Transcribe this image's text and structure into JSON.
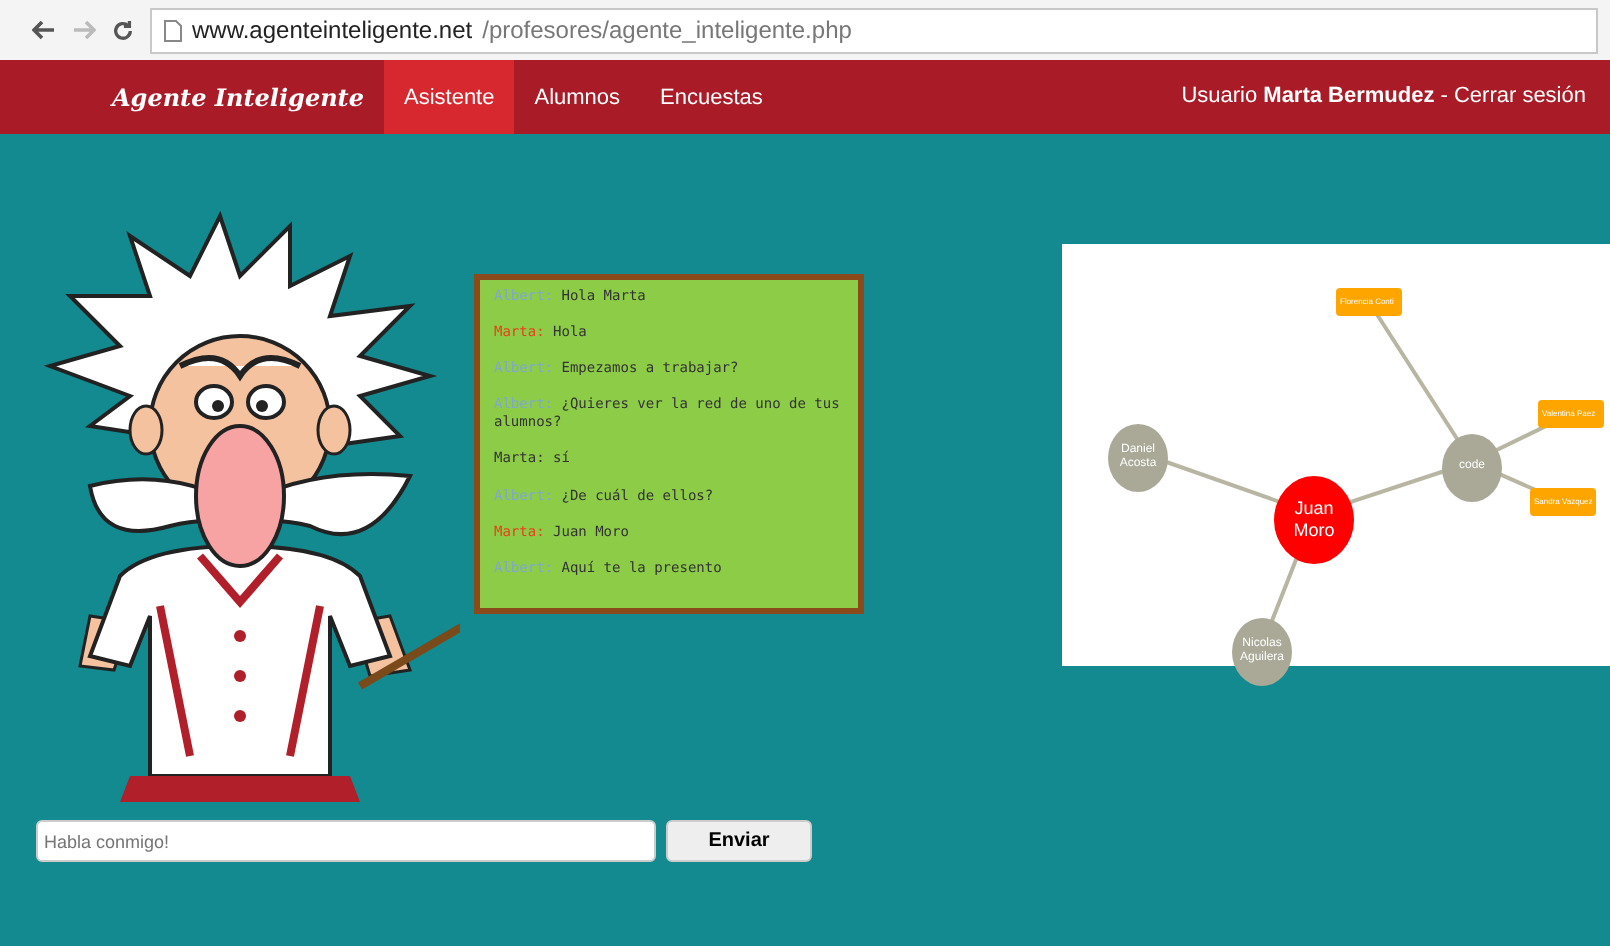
{
  "browser": {
    "url_domain": "www.agenteinteligente.net",
    "url_path": "/profesores/agente_inteligente.php"
  },
  "navbar": {
    "brand": "Agente Inteligente",
    "items": [
      {
        "label": "Asistente",
        "selected": true
      },
      {
        "label": "Alumnos",
        "selected": false
      },
      {
        "label": "Encuestas",
        "selected": false
      }
    ],
    "user_prefix": "Usuario",
    "user_name": "Marta Bermudez",
    "separator": "-",
    "logout": "Cerrar sesión"
  },
  "chat": {
    "messages": [
      {
        "speaker": "Albert:",
        "color": "#7fa6d8",
        "text": "Hola Marta"
      },
      {
        "speaker": "Marta:",
        "color": "#e8401c",
        "text": "Hola"
      },
      {
        "speaker": "Albert:",
        "color": "#7fa6d8",
        "text": "Empezamos a trabajar?"
      },
      {
        "speaker": "Albert:",
        "color": "#7fa6d8",
        "text": "¿Quieres ver la red de uno de tus alumnos?"
      },
      {
        "speaker": "Marta:",
        "color": "#333333",
        "text": "sí"
      },
      {
        "speaker": "Albert:",
        "color": "#7fa6d8",
        "text": "¿De cuál de ellos?"
      },
      {
        "speaker": "Marta:",
        "color": "#e8401c",
        "text": "Juan Moro"
      },
      {
        "speaker": "Albert:",
        "color": "#7fa6d8",
        "text": "Aquí te la presento"
      }
    ]
  },
  "network": {
    "nodes": [
      {
        "label": "Juan Moro",
        "kind": "center"
      },
      {
        "label": "Daniel Acosta",
        "kind": "person"
      },
      {
        "label": "Nicolas Aguilera",
        "kind": "person"
      },
      {
        "label": "code",
        "kind": "person"
      },
      {
        "label": "Florencia Conti",
        "kind": "tag"
      },
      {
        "label": "Valentina Paez",
        "kind": "tag"
      },
      {
        "label": "Sandra Vazquez",
        "kind": "tag"
      }
    ]
  },
  "input": {
    "placeholder": "Habla conmigo!",
    "button": "Enviar"
  }
}
